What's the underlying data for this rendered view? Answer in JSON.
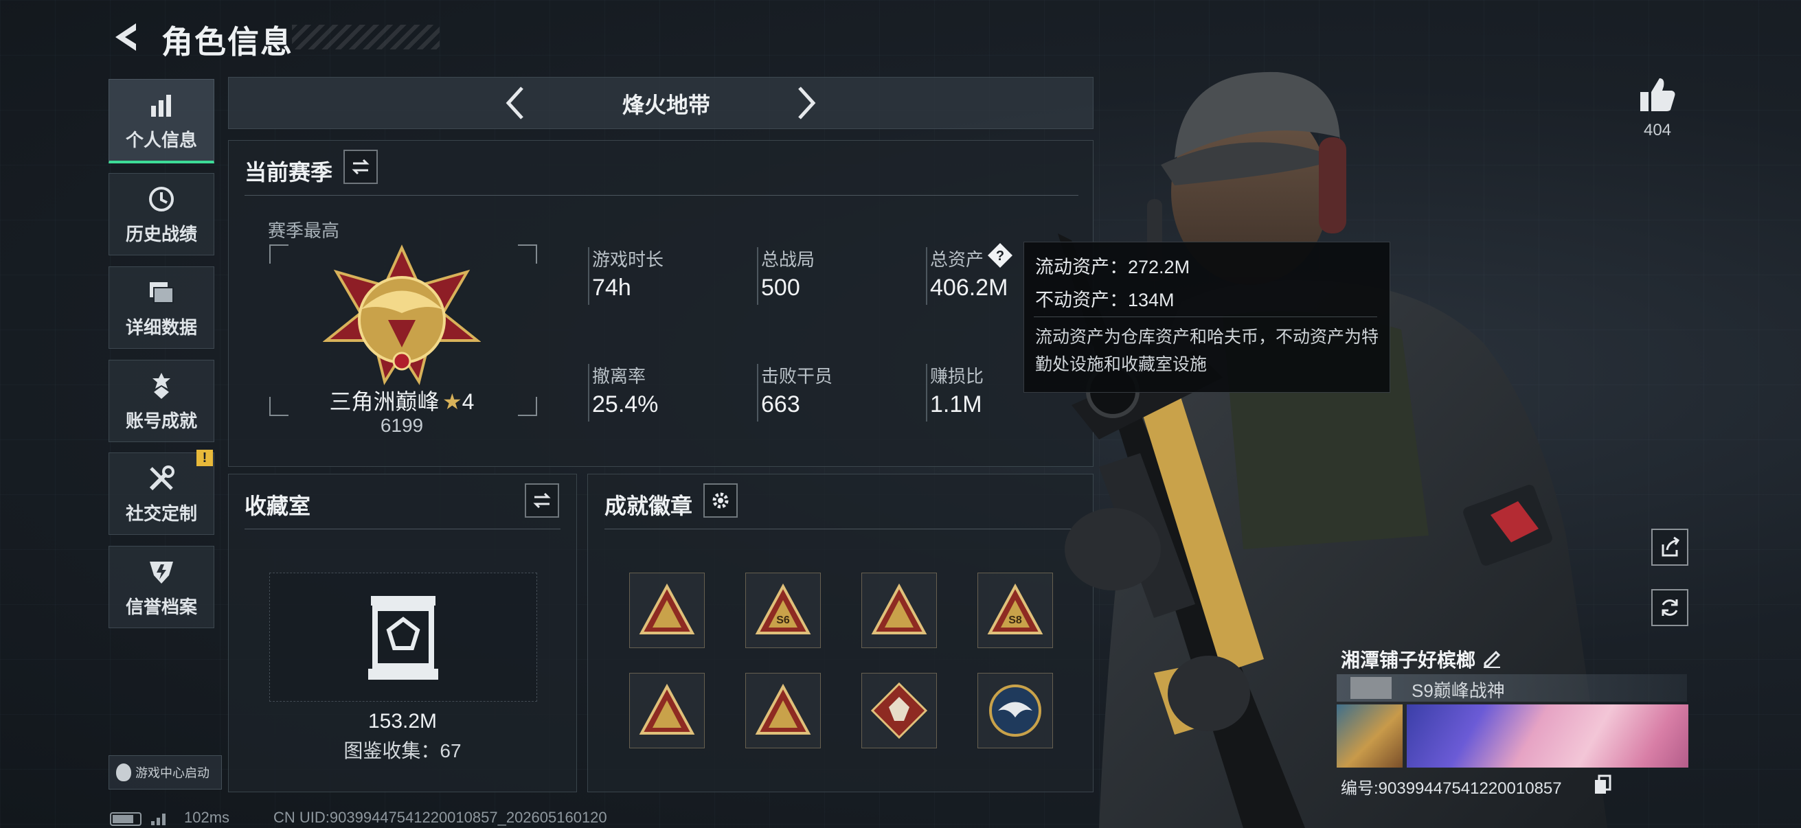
{
  "header": {
    "title": "角色信息"
  },
  "sidebar": {
    "items": [
      {
        "label": "个人信息",
        "icon": "bar-chart-icon",
        "active": true
      },
      {
        "label": "历史战绩",
        "icon": "history-icon"
      },
      {
        "label": "详细数据",
        "icon": "folders-icon"
      },
      {
        "label": "账号成就",
        "icon": "achievement-icon"
      },
      {
        "label": "社交定制",
        "icon": "tools-icon",
        "badge": "!"
      },
      {
        "label": "信誉档案",
        "icon": "credit-icon"
      }
    ],
    "game_center": "游戏中心启动"
  },
  "mode": {
    "name": "烽火地带"
  },
  "season": {
    "title": "当前赛季",
    "best_label": "赛季最高",
    "rank_name": "三角洲巅峰",
    "rank_stars": "4",
    "rank_score": "6199",
    "stats": [
      {
        "label": "游戏时长",
        "value": "74h"
      },
      {
        "label": "总战局",
        "value": "500"
      },
      {
        "label": "总资产",
        "value": "406.2M"
      },
      {
        "label": "撤离率",
        "value": "25.4%"
      },
      {
        "label": "击败干员",
        "value": "663"
      },
      {
        "label": "赚损比",
        "value": "1.1M"
      }
    ]
  },
  "tooltip": {
    "liquid": "流动资产：272.2M",
    "fixed": "不动资产：134M",
    "desc": "流动资产为仓库资产和哈夫币，不动资产为特勤处设施和收藏室设施"
  },
  "vault": {
    "title": "收藏室",
    "value": "153.2M",
    "collection": "图鉴收集：67"
  },
  "badges": {
    "title": "成就徽章",
    "items": [
      {
        "icon": "triangle-badge-icon",
        "text": ""
      },
      {
        "icon": "triangle-badge-s6-icon",
        "text": "S6"
      },
      {
        "icon": "triangle-badge-icon",
        "text": ""
      },
      {
        "icon": "triangle-badge-s8-icon",
        "text": "S8"
      },
      {
        "icon": "triangle-badge-icon",
        "text": ""
      },
      {
        "icon": "triangle-badge-icon",
        "text": ""
      },
      {
        "icon": "diamond-beast-badge-icon",
        "text": ""
      },
      {
        "icon": "eagle-round-badge-icon",
        "text": ""
      }
    ]
  },
  "player": {
    "likes": "404",
    "name": "湘潭铺子好槟榔",
    "title": "S9巅峰战神",
    "uid": "编号:90399447541220010857"
  },
  "footer": {
    "ping": "102ms",
    "cn_uid": "CN UID:90399447541220010857_202605160120"
  },
  "colors": {
    "accent": "#3ddc97",
    "warn": "#e8b93a",
    "gold": "#c9a24a"
  }
}
